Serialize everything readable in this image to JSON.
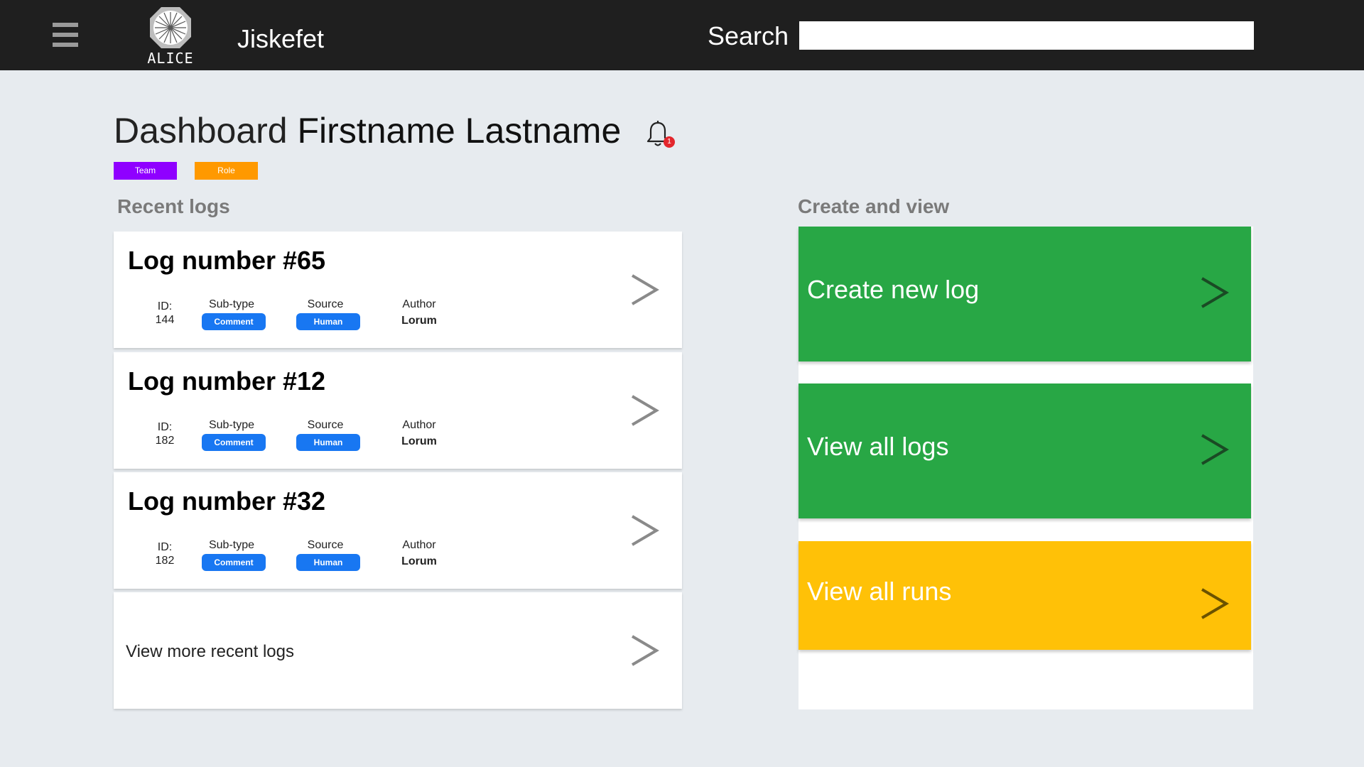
{
  "header": {
    "logo_text": "ALICE",
    "app_title": "Jiskefet",
    "search_label": "Search",
    "search_value": "",
    "search_placeholder": ""
  },
  "dashboard": {
    "title_prefix": "Dashboard",
    "user_name": "Firstname Lastname",
    "notification_count": "1",
    "tags": {
      "team": "Team",
      "role": "Role"
    }
  },
  "recent_logs": {
    "section_title": "Recent logs",
    "labels": {
      "id": "ID:",
      "subtype": "Sub-type",
      "source": "Source",
      "author": "Author"
    },
    "items": [
      {
        "title": "Log number #65",
        "id": "144",
        "subtype": "Comment",
        "source": "Human",
        "author": "Lorum"
      },
      {
        "title": "Log number #12",
        "id": "182",
        "subtype": "Comment",
        "source": "Human",
        "author": "Lorum"
      },
      {
        "title": "Log number #32",
        "id": "182",
        "subtype": "Comment",
        "source": "Human",
        "author": "Lorum"
      }
    ],
    "view_more": "View more recent logs"
  },
  "create_view": {
    "section_title": "Create and view",
    "actions": [
      {
        "label": "Create new log",
        "color": "#28a745"
      },
      {
        "label": "View all logs",
        "color": "#28a745"
      },
      {
        "label": "View all runs",
        "color": "#ffc107"
      }
    ]
  },
  "colors": {
    "topbar": "#1f1f1f",
    "background": "#e7ebef",
    "pill": "#1877f2",
    "team_tag": "#8f00ff",
    "role_tag": "#ff9900",
    "badge": "#e3262c"
  },
  "icons": [
    "hamburger-menu-icon",
    "alice-logo-icon",
    "bell-icon",
    "chevron-right-icon"
  ]
}
